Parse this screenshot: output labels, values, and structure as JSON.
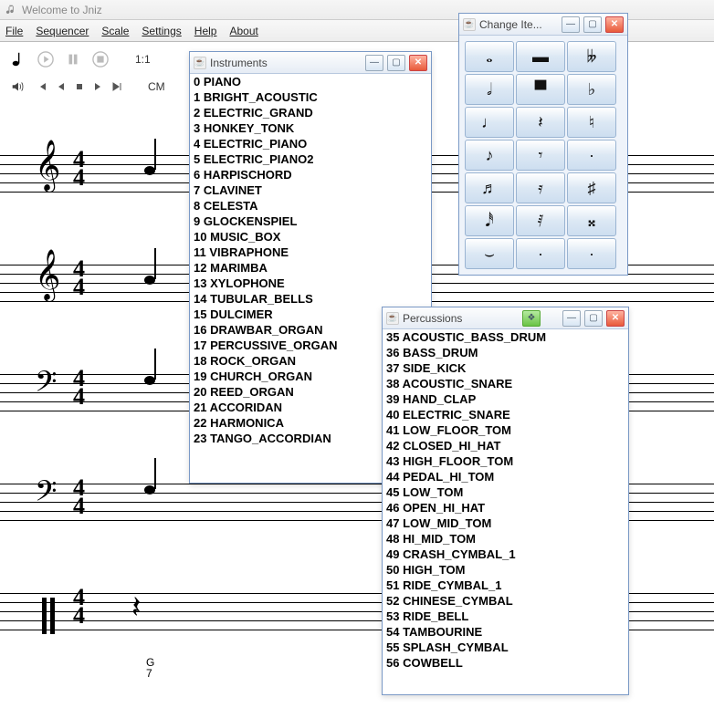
{
  "app_title": "Welcome to Jniz",
  "menu": [
    "File",
    "Sequencer",
    "Scale",
    "Settings",
    "Help",
    "About"
  ],
  "toolbar": {
    "ratio": "1:1",
    "key": "CM"
  },
  "chord": {
    "root": "G",
    "num": "7"
  },
  "windows": {
    "instruments": {
      "title": "Instruments",
      "items": [
        "0 PIANO",
        "1 BRIGHT_ACOUSTIC",
        "2 ELECTRIC_GRAND",
        "3 HONKEY_TONK",
        "4 ELECTRIC_PIANO",
        "5 ELECTRIC_PIANO2",
        "6 HARPISCHORD",
        "7 CLAVINET",
        "8 CELESTA",
        "9 GLOCKENSPIEL",
        "10 MUSIC_BOX",
        "11 VIBRAPHONE",
        "12 MARIMBA",
        "13 XYLOPHONE",
        "14 TUBULAR_BELLS",
        "15 DULCIMER",
        "16 DRAWBAR_ORGAN",
        "17 PERCUSSIVE_ORGAN",
        "18 ROCK_ORGAN",
        "19 CHURCH_ORGAN",
        "20 REED_ORGAN",
        "21 ACCORIDAN",
        "22 HARMONICA",
        "23 TANGO_ACCORDIAN"
      ]
    },
    "percussions": {
      "title": "Percussions",
      "items": [
        "35 ACOUSTIC_BASS_DRUM",
        "36 BASS_DRUM",
        "37 SIDE_KICK",
        "38 ACOUSTIC_SNARE",
        "39 HAND_CLAP",
        "40 ELECTRIC_SNARE",
        "41 LOW_FLOOR_TOM",
        "42 CLOSED_HI_HAT",
        "43 HIGH_FLOOR_TOM",
        "44 PEDAL_HI_TOM",
        "45 LOW_TOM",
        "46 OPEN_HI_HAT",
        "47 LOW_MID_TOM",
        "48 HI_MID_TOM",
        "49 CRASH_CYMBAL_1",
        "50 HIGH_TOM",
        "51 RIDE_CYMBAL_1",
        "52 CHINESE_CYMBAL",
        "53 RIDE_BELL",
        "54 TAMBOURINE",
        "55 SPLASH_CYMBAL",
        "56 COWBELL"
      ]
    },
    "change_item": {
      "title": "Change Ite...",
      "cells": [
        {
          "name": "whole-note-icon"
        },
        {
          "name": "whole-rest-icon"
        },
        {
          "name": "double-flat-icon"
        },
        {
          "name": "half-note-icon"
        },
        {
          "name": "half-rest-icon"
        },
        {
          "name": "flat-icon"
        },
        {
          "name": "quarter-note-icon"
        },
        {
          "name": "quarter-rest-icon"
        },
        {
          "name": "natural-icon"
        },
        {
          "name": "eighth-note-icon"
        },
        {
          "name": "eighth-rest-icon"
        },
        {
          "name": "dot-icon"
        },
        {
          "name": "sixteenth-note-icon"
        },
        {
          "name": "sixteenth-rest-icon"
        },
        {
          "name": "sharp-icon"
        },
        {
          "name": "thirtysecond-note-icon"
        },
        {
          "name": "thirtysecond-rest-icon"
        },
        {
          "name": "double-sharp-icon"
        },
        {
          "name": "tie-icon"
        },
        {
          "name": "blank-icon"
        },
        {
          "name": "blank2-icon"
        }
      ]
    }
  },
  "staves": [
    {
      "clef": "treble",
      "time": "4/4"
    },
    {
      "clef": "treble",
      "time": "4/4"
    },
    {
      "clef": "bass",
      "time": "4/4"
    },
    {
      "clef": "bass",
      "time": "4/4"
    },
    {
      "clef": "perc",
      "time": "4/4"
    }
  ]
}
